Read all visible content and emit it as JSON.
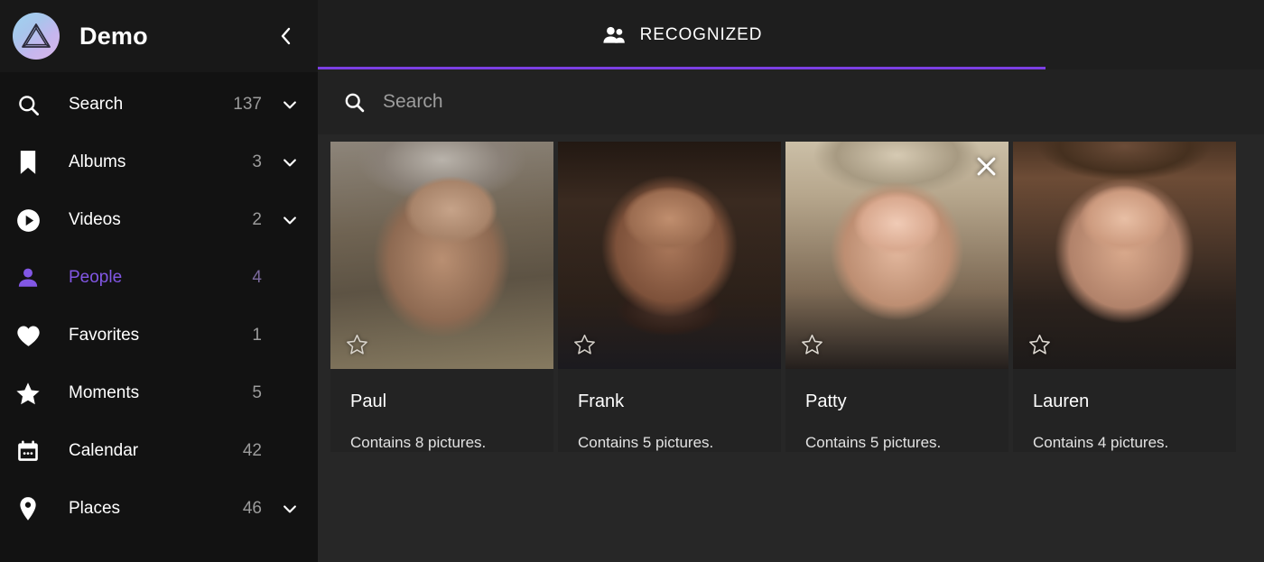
{
  "sidebar": {
    "brand": {
      "title": "Demo",
      "logo_icon": "triangle-logo-icon"
    },
    "collapse_icon": "chevron-left-icon",
    "items": [
      {
        "label": "Search",
        "count": "137",
        "icon": "search-icon",
        "expandable": true,
        "active": false
      },
      {
        "label": "Albums",
        "count": "3",
        "icon": "bookmark-icon",
        "expandable": true,
        "active": false
      },
      {
        "label": "Videos",
        "count": "2",
        "icon": "play-circle-icon",
        "expandable": true,
        "active": false
      },
      {
        "label": "People",
        "count": "4",
        "icon": "person-icon",
        "expandable": false,
        "active": true
      },
      {
        "label": "Favorites",
        "count": "1",
        "icon": "heart-icon",
        "expandable": false,
        "active": false
      },
      {
        "label": "Moments",
        "count": "5",
        "icon": "star-icon",
        "expandable": false,
        "active": false
      },
      {
        "label": "Calendar",
        "count": "42",
        "icon": "calendar-icon",
        "expandable": false,
        "active": false
      },
      {
        "label": "Places",
        "count": "46",
        "icon": "map-pin-icon",
        "expandable": true,
        "active": false
      }
    ]
  },
  "main": {
    "tabs": [
      {
        "label": "RECOGNIZED",
        "icon": "people-icon",
        "active": true
      }
    ],
    "search": {
      "value": "",
      "placeholder": "Search",
      "icon": "search-icon"
    },
    "cards": [
      {
        "name": "Paul",
        "subtitle": "Contains 8 pictures.",
        "favorite": false,
        "show_close": false,
        "face_class": "f-paul"
      },
      {
        "name": "Frank",
        "subtitle": "Contains 5 pictures.",
        "favorite": false,
        "show_close": false,
        "face_class": "f-frank"
      },
      {
        "name": "Patty",
        "subtitle": "Contains 5 pictures.",
        "favorite": false,
        "show_close": true,
        "face_class": "f-patty"
      },
      {
        "name": "Lauren",
        "subtitle": "Contains 4 pictures.",
        "favorite": false,
        "show_close": false,
        "face_class": "f-lauren"
      }
    ]
  },
  "colors": {
    "accent_purple": "#8257e5",
    "tab_underline": "#7c3fe4",
    "sidebar_bg": "#121212",
    "sidebar_header_bg": "#181818",
    "main_bg": "#272727",
    "tabbar_bg": "#1e1e1e",
    "searchbar_bg": "#222222",
    "card_bg": "#232323",
    "count_text": "#9b9b9b"
  }
}
